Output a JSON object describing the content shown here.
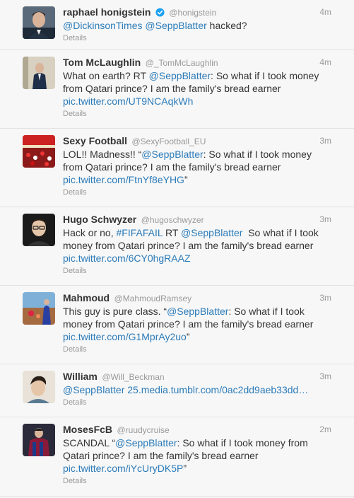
{
  "tweets": [
    {
      "name": "raphael honigstein",
      "verified": true,
      "handle": "@honigstein",
      "time": "4m",
      "parts": [
        {
          "t": "@DickinsonTimes",
          "link": true
        },
        {
          "t": " ",
          "link": false
        },
        {
          "t": "@SeppBlatter",
          "link": true
        },
        {
          "t": " hacked?",
          "link": false
        }
      ],
      "details": "Details",
      "avatar": "avatar-raphael"
    },
    {
      "name": "Tom McLaughlin",
      "verified": false,
      "handle": "@_TomMcLaughlin",
      "time": "4m",
      "parts": [
        {
          "t": "What on earth? RT ",
          "link": false
        },
        {
          "t": "@SeppBlatter",
          "link": true
        },
        {
          "t": ": So what if I took money from Qatari prince? I am the family's bread earner ",
          "link": false
        },
        {
          "t": "pic.twitter.com/UT9NCAqkWh",
          "link": true
        }
      ],
      "details": "Details",
      "avatar": "avatar-tom"
    },
    {
      "name": "Sexy Football",
      "verified": false,
      "handle": "@SexyFootball_EU",
      "time": "3m",
      "parts": [
        {
          "t": "LOL!! Madness!! “",
          "link": false
        },
        {
          "t": "@SeppBlatter",
          "link": true
        },
        {
          "t": ": So what if I took money from Qatari prince? I am the family's bread earner ",
          "link": false
        },
        {
          "t": "pic.twitter.com/FtnYf8eYHG",
          "link": true
        },
        {
          "t": "”",
          "link": false
        }
      ],
      "details": "Details",
      "avatar": "avatar-sexyfootball"
    },
    {
      "name": "Hugo Schwyzer",
      "verified": false,
      "handle": "@hugoschwyzer",
      "time": "3m",
      "parts": [
        {
          "t": "Hack or no, ",
          "link": false
        },
        {
          "t": "#FIFAFAIL",
          "link": true
        },
        {
          "t": " RT ",
          "link": false
        },
        {
          "t": "@SeppBlatter",
          "link": true
        },
        {
          "t": "  So what if I took money from Qatari prince? I am the family's bread earner ",
          "link": false
        },
        {
          "t": "pic.twitter.com/6CY0hgRAAZ",
          "link": true
        }
      ],
      "details": "Details",
      "avatar": "avatar-hugo"
    },
    {
      "name": "Mahmoud",
      "verified": false,
      "handle": "@MahmoudRamsey",
      "time": "3m",
      "parts": [
        {
          "t": "This guy is pure class. “",
          "link": false
        },
        {
          "t": "@SeppBlatter",
          "link": true
        },
        {
          "t": ": So what if I took money from Qatari prince? I am the family's bread earner ",
          "link": false
        },
        {
          "t": "pic.twitter.com/G1MprAy2uo",
          "link": true
        },
        {
          "t": "”",
          "link": false
        }
      ],
      "details": "Details",
      "avatar": "avatar-mahmoud"
    },
    {
      "name": "William",
      "verified": false,
      "handle": "@Will_Beckman",
      "time": "3m",
      "parts": [
        {
          "t": "@SeppBlatter",
          "link": true
        },
        {
          "t": " ",
          "link": false
        },
        {
          "t": "25.media.tumblr.com/0ac2dd9aeb33dd…",
          "link": true
        }
      ],
      "details": "Details",
      "avatar": "avatar-william"
    },
    {
      "name": "MosesFcB",
      "verified": false,
      "handle": "@ruudycruise",
      "time": "2m",
      "parts": [
        {
          "t": "SCANDAL “",
          "link": false
        },
        {
          "t": "@SeppBlatter",
          "link": true
        },
        {
          "t": ": So what if I took money from Qatari prince? I am the family's bread earner ",
          "link": false
        },
        {
          "t": "pic.twitter.com/iYcUryDK5P",
          "link": true
        },
        {
          "t": "”",
          "link": false
        }
      ],
      "details": "Details",
      "avatar": "avatar-moses"
    }
  ],
  "colors": {
    "link": "#2b7bb9",
    "muted": "#999999",
    "verified": "#1da1f2"
  }
}
